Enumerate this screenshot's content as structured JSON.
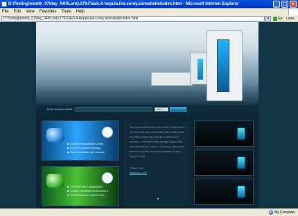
{
  "window": {
    "title": "D:\\Testing\\month_07\\day_04\\f\\Lonly.279.Flash.A-tequila.lire.corey.simnal\\site\\index.html - Microsoft Internet Explorer"
  },
  "menubar": {
    "items": [
      "File",
      "Edit",
      "View",
      "Favorites",
      "Tools",
      "Help"
    ]
  },
  "addressbar": {
    "value": "D:\\Testing\\month_07\\day_04\\f\\Lonly.279.Flash.A-tequila.lire.corey.simnal\\site\\index.html",
    "go_label": "Go",
    "links_label": "Links"
  },
  "site": {
    "domain_label": "Enter Domain Name:",
    "tld_selected": ".com",
    "feature_blue": [
      "Unlimited Bandwidth Limits",
      "25 GB Protected Storage",
      "Host 8 websites per account"
    ],
    "feature_green": [
      "1000 GB Tier 1 Bandwidth",
      "Unique Hardware Environment",
      "99.5% Network Uptime SLA"
    ],
    "text": {
      "paragraph": "You guys are the best web host I have found. You provide your customers with really good and fast support as well as a plethora of services. Unlimited web storage space with also providing it a fast, I have had have been resolved quickly and easily thanks to your support staff.",
      "thanks": "Thank You!",
      "link": "sitebrand.com"
    }
  },
  "statusbar": {
    "left": "",
    "right": "My Computer"
  }
}
